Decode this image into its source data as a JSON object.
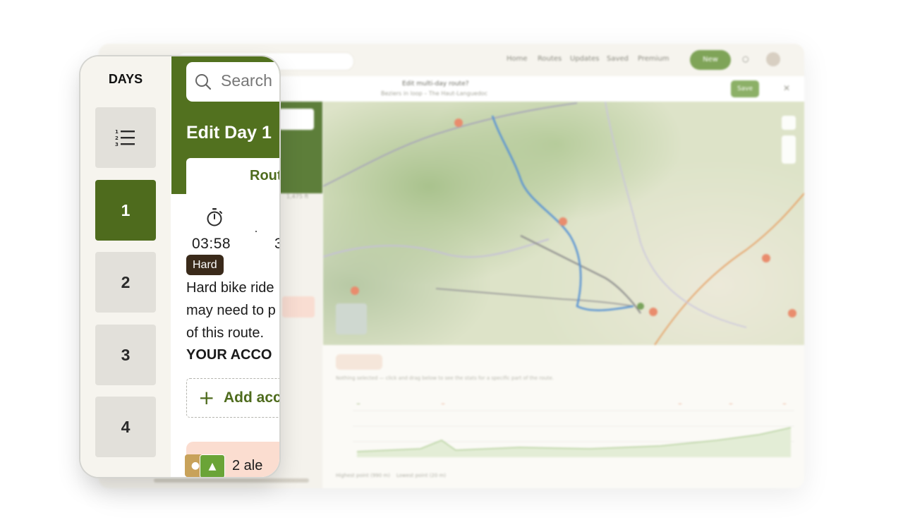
{
  "days_panel": {
    "title": "DAYS",
    "list_icon": "numbered-list-icon",
    "days": [
      {
        "label": "1",
        "active": true
      },
      {
        "label": "2",
        "active": false
      },
      {
        "label": "3",
        "active": false
      },
      {
        "label": "4",
        "active": false
      }
    ]
  },
  "edit_panel": {
    "search_placeholder": "Search",
    "title": "Edit Day 1",
    "route_tab_label": "Rout",
    "stopwatch_icon": "stopwatch-icon",
    "duration": "03:58",
    "stat_partial": "3",
    "difficulty": "Hard",
    "description_lines": [
      "Hard bike ride",
      "may need to p",
      "of this route."
    ],
    "accommodation_heading": "YOUR ACCO",
    "add_accommodation_label": "Add acc",
    "alerts_label": "2 ale",
    "alert_icons": [
      "bike-icon",
      "park-icon"
    ]
  },
  "background_app": {
    "nav_links": [
      "Home",
      "Routes",
      "Updates",
      "Saved",
      "Premium"
    ],
    "new_button": "New",
    "edit_title": "Edit multi-day route?",
    "edit_subtitle": "Beziers in loop – The Haut-Languedoc",
    "save_button": "Save",
    "elevation_button": "Elevation",
    "elevation_note": "Nothing selected — click and drag below to see the stats for a specific part of the route.",
    "legend_high": "Highest point (990 m)",
    "legend_low": "Lowest point (20 m)",
    "side_note": "1,475 ft",
    "colors": {
      "accent_green": "#4e6b1d",
      "header_green": "#52711f",
      "badge_brown": "#3a2a1a",
      "alert_pink": "#fbddd0"
    }
  }
}
